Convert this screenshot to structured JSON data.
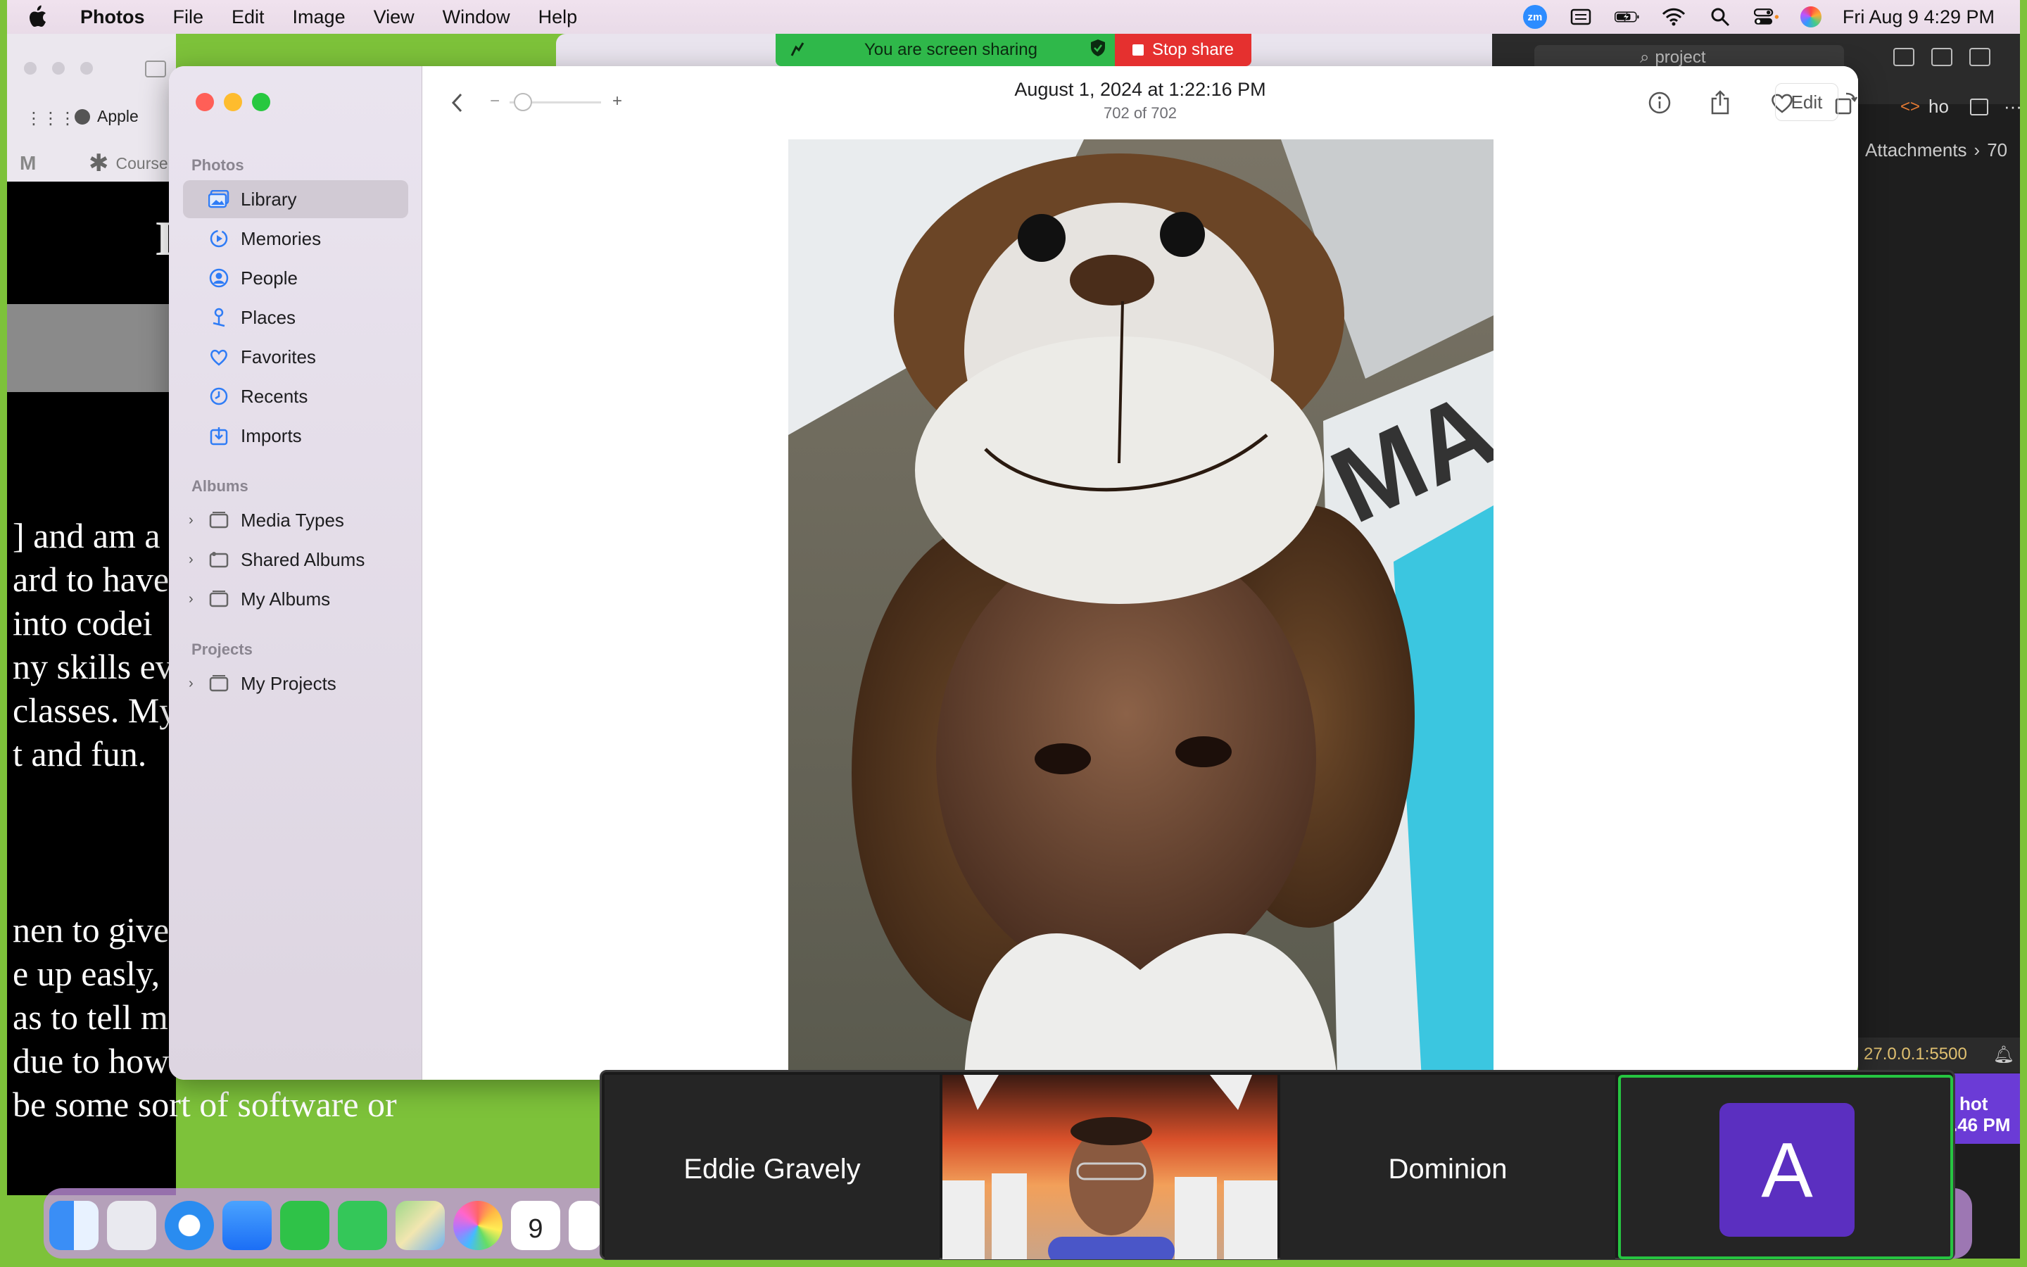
{
  "menubar": {
    "app_name": "Photos",
    "items": [
      "File",
      "Edit",
      "Image",
      "View",
      "Window",
      "Help"
    ],
    "zoom_badge": "zm",
    "clock": "Fri Aug 9  4:29 PM"
  },
  "background": {
    "bookmark_apple": "Apple",
    "tab_course": "Course",
    "search_project": "project",
    "editor_tab": "ho",
    "breadcrumb": "Attachments",
    "breadcrumb_num": "70",
    "server_status": "27.0.0.1:5500",
    "screenshot_label_1": "hot",
    "screenshot_label_2": ".46 PM",
    "doc_title_char": "I",
    "doc_lines": [
      "] and am a",
      "ard to have",
      " into codei",
      "ny skills ev",
      "classes. My",
      "t and fun.",
      "nen to give",
      "e up easly, s",
      "as to tell me",
      "due to how",
      "be some sort of software or"
    ]
  },
  "share_banner": {
    "message": "You are screen sharing",
    "stop_label": "Stop share"
  },
  "photos": {
    "sidebar": {
      "section_photos": "Photos",
      "library": [
        {
          "label": "Library",
          "icon": "library-icon",
          "selected": true
        },
        {
          "label": "Memories",
          "icon": "memories-icon"
        },
        {
          "label": "People",
          "icon": "people-icon"
        },
        {
          "label": "Places",
          "icon": "places-icon"
        },
        {
          "label": "Favorites",
          "icon": "heart-icon"
        },
        {
          "label": "Recents",
          "icon": "clock-icon"
        },
        {
          "label": "Imports",
          "icon": "import-icon"
        }
      ],
      "section_albums": "Albums",
      "albums": [
        {
          "label": "Media Types"
        },
        {
          "label": "Shared Albums"
        },
        {
          "label": "My Albums"
        }
      ],
      "section_projects": "Projects",
      "projects": [
        {
          "label": "My Projects"
        }
      ]
    },
    "toolbar": {
      "title": "August 1, 2024 at 1:22:16 PM",
      "subtitle": "702 of 702",
      "zoom_minus": "−",
      "zoom_plus": "+",
      "edit_label": "Edit"
    },
    "photo_alt": "Selfie wearing a plush monkey hat",
    "photo_text": "MA"
  },
  "zoom": {
    "participants": [
      {
        "name": "Eddie Gravely",
        "type": "name"
      },
      {
        "name": "",
        "type": "video"
      },
      {
        "name": "Dominion",
        "type": "name"
      },
      {
        "name": "A",
        "type": "avatar",
        "color": "#5b2fc0",
        "active": true
      }
    ]
  },
  "colors": {
    "share_green": "#2fb84a",
    "stop_red": "#e5302f",
    "active_speaker": "#26c541",
    "avatar_purple": "#5b2fc0",
    "desktop_border": "#7dc23a"
  }
}
